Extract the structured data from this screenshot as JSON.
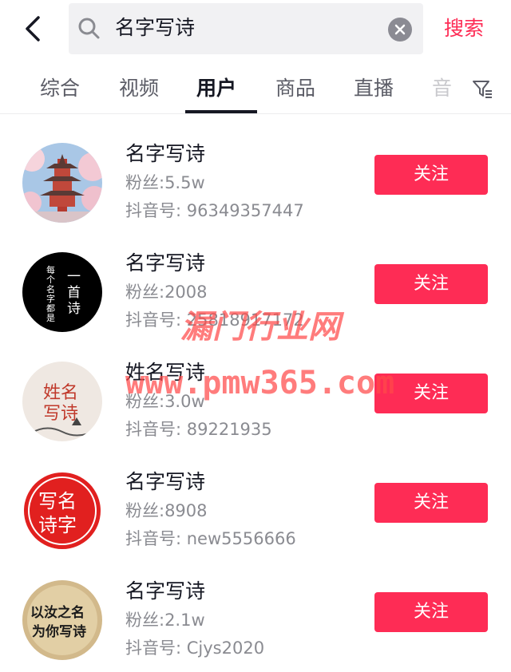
{
  "search": {
    "query": "名字写诗",
    "submit_label": "搜索"
  },
  "tabs": [
    "综合",
    "视频",
    "用户",
    "商品",
    "直播",
    "音"
  ],
  "users": [
    {
      "name": "名字写诗",
      "fans": "粉丝:5.5w",
      "id": "抖音号: 96349357447",
      "follow_label": "关注",
      "avatar": "pagoda"
    },
    {
      "name": "名字写诗",
      "fans": "粉丝:2008",
      "id": "抖音号: 25818917172",
      "follow_label": "关注",
      "avatar": "black-circle"
    },
    {
      "name": "姓名写诗",
      "fans": "粉丝:3.0w",
      "id": "抖音号: 89221935",
      "follow_label": "关注",
      "avatar": "ink-painting"
    },
    {
      "name": "名字写诗",
      "fans": "粉丝:8908",
      "id": "抖音号: new5556666",
      "follow_label": "关注",
      "avatar": "red-seal"
    },
    {
      "name": "名字写诗",
      "fans": "粉丝:2.1w",
      "id": "抖音号: Cjys2020",
      "follow_label": "关注",
      "avatar": "calligraphy"
    }
  ],
  "avatar_text": {
    "black": {
      "left": "每个名字都是",
      "right": "一首诗"
    },
    "ink": "姓名写诗",
    "seal": [
      "写名",
      "诗字"
    ],
    "calligraphy": [
      "以汝之名",
      "为你写诗"
    ]
  },
  "watermark": {
    "line1": "漏门行业网",
    "line2": "www.pmw365.com"
  },
  "colors": {
    "accent": "#fe2c55",
    "text": "#161823",
    "muted": "#8a8b91"
  }
}
